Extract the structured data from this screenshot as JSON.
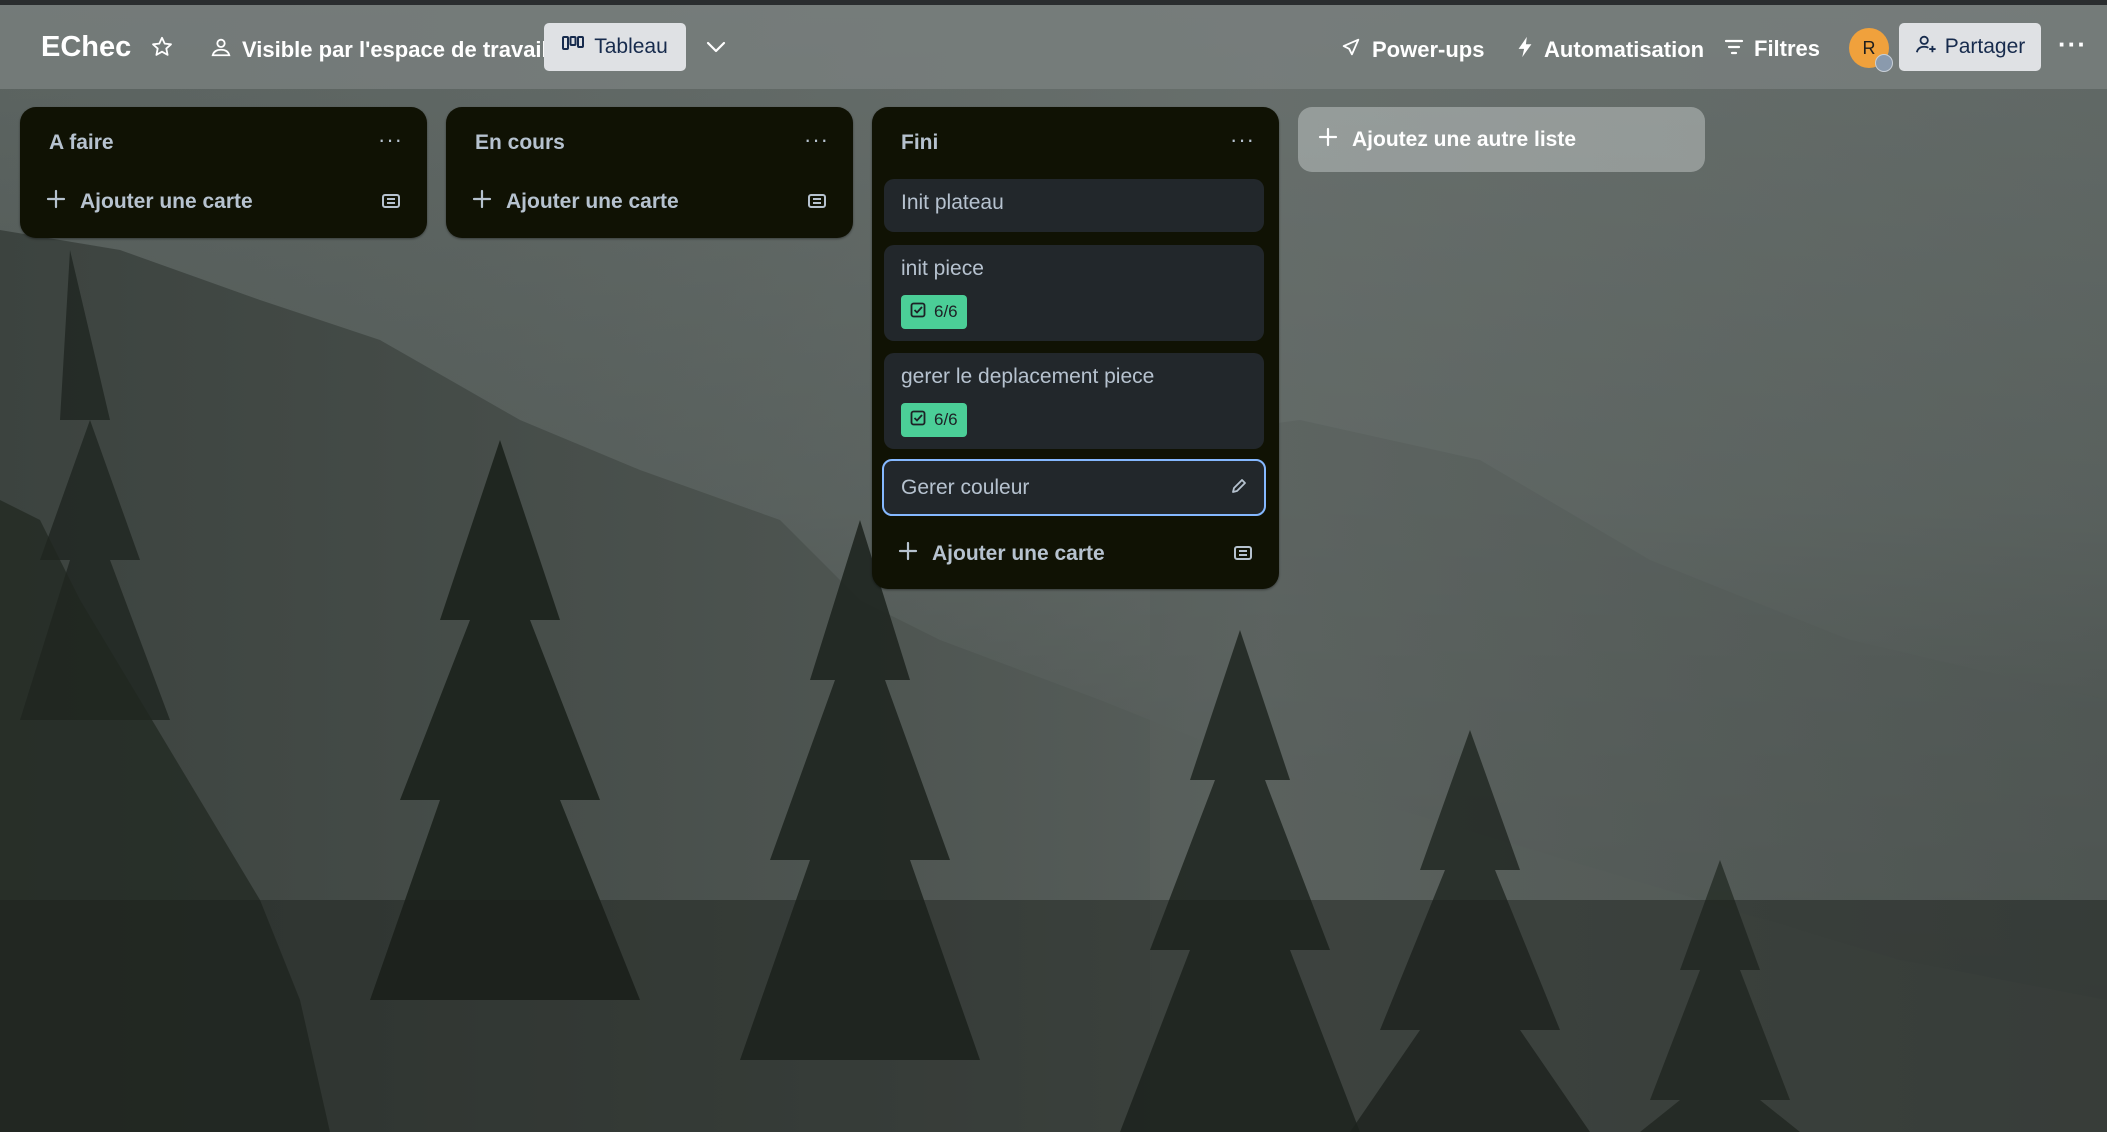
{
  "header": {
    "board_title": "EChec",
    "star_icon": "star-icon",
    "visibility_label": "Visible par l'espace de travail",
    "view_label": "Tableau",
    "powerups_label": "Power-ups",
    "automation_label": "Automatisation",
    "filters_label": "Filtres",
    "avatar_initial": "R",
    "share_label": "Partager",
    "more_label": "···"
  },
  "lists": [
    {
      "title": "A faire",
      "menu": "···",
      "add_card_label": "Ajouter une carte",
      "cards": []
    },
    {
      "title": "En cours",
      "menu": "···",
      "add_card_label": "Ajouter une carte",
      "cards": []
    },
    {
      "title": "Fini",
      "menu": "···",
      "add_card_label": "Ajouter une carte",
      "cards": [
        {
          "title": "Init plateau"
        },
        {
          "title": "init piece",
          "checklist": "6/6"
        },
        {
          "title": "gerer le deplacement piece",
          "checklist": "6/6"
        },
        {
          "title": "Gerer couleur",
          "selected": true
        }
      ]
    }
  ],
  "add_list_label": "Ajoutez une autre liste",
  "colors": {
    "list_bg": "#101204",
    "card_bg": "#22272b",
    "checklist_complete": "#4bce97",
    "focus_border": "#85b8ff",
    "avatar": "#f0a13c"
  }
}
